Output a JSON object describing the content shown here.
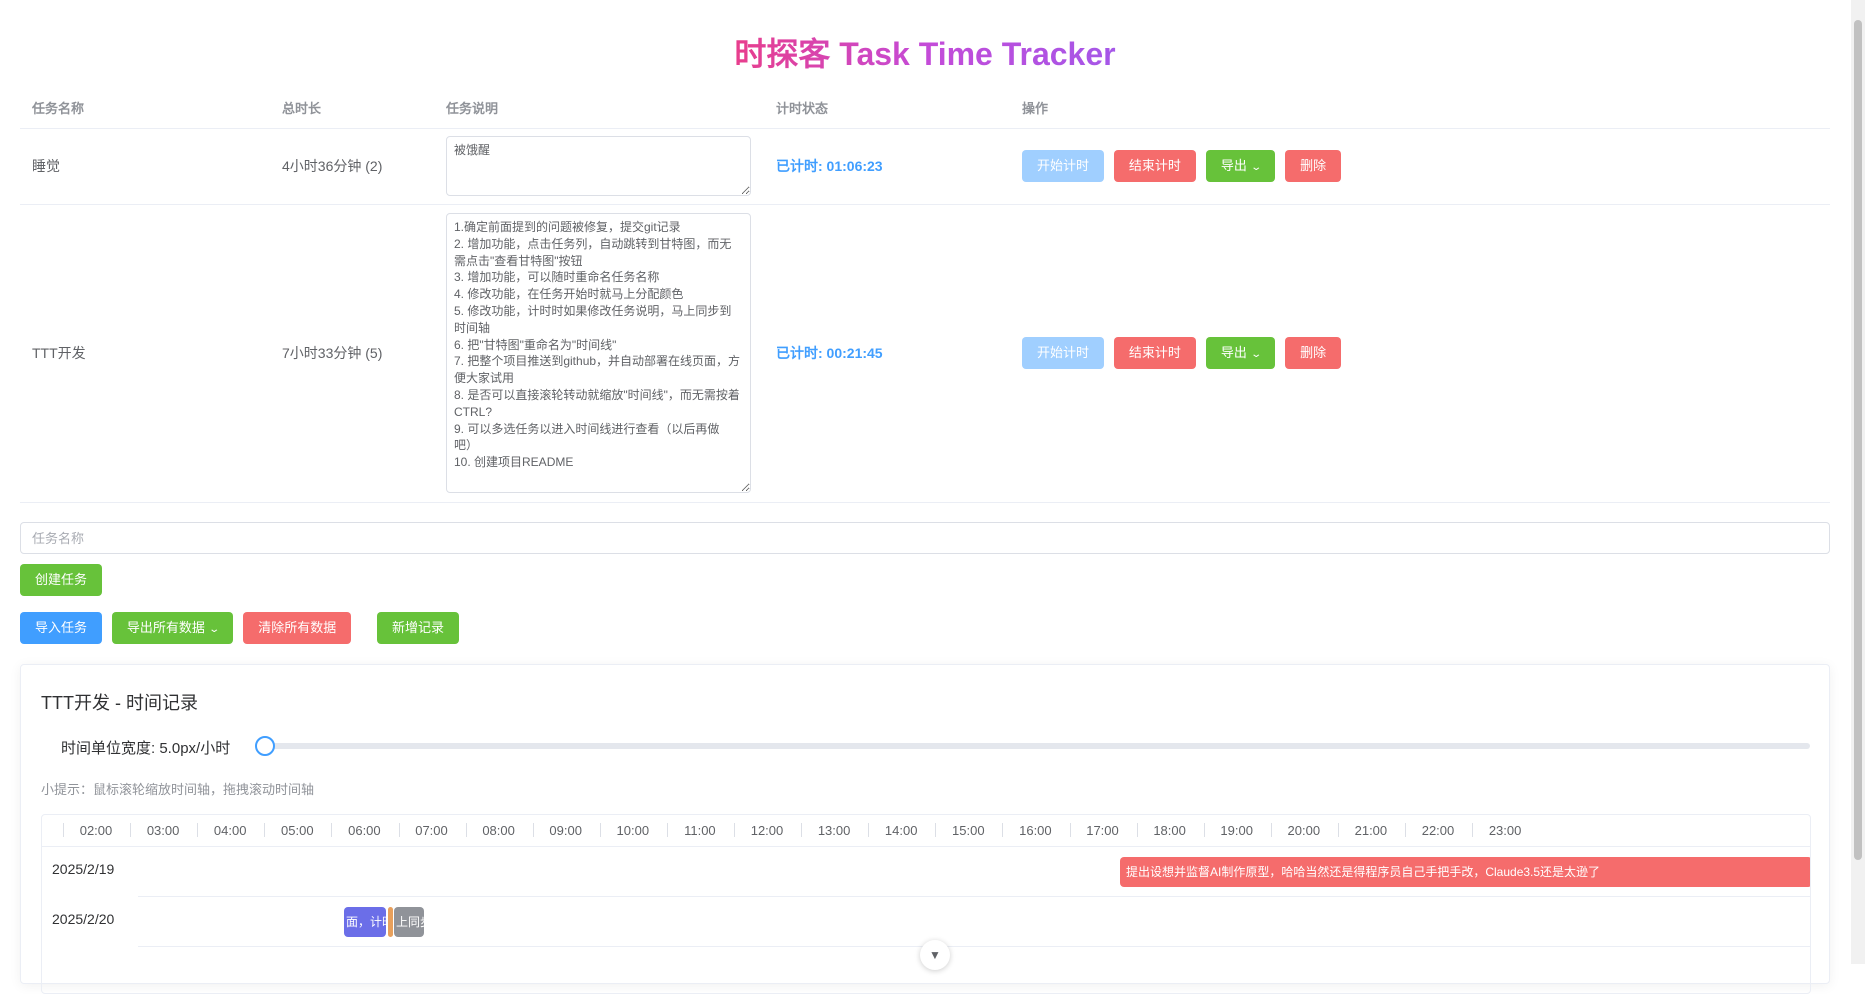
{
  "app": {
    "title": "时探客 Task Time Tracker"
  },
  "table": {
    "headers": [
      "任务名称",
      "总时长",
      "任务说明",
      "计时状态",
      "操作"
    ],
    "rows": [
      {
        "name": "睡觉",
        "total": "4小时36分钟 (2)",
        "desc": "被饿醒",
        "status": "已计时: 01:06:23"
      },
      {
        "name": "TTT开发",
        "total": "7小时33分钟 (5)",
        "desc": "1.确定前面提到的问题被修复，提交git记录\n2. 增加功能，点击任务列，自动跳转到甘特图，而无需点击\"查看甘特图\"按钮\n3. 增加功能，可以随时重命名任务名称\n4. 修改功能，在任务开始时就马上分配颜色\n5. 修改功能，计时时如果修改任务说明，马上同步到时间轴\n6. 把\"甘特图\"重命名为\"时间线\"\n7. 把整个项目推送到github，并自动部署在线页面，方便大家试用\n8. 是否可以直接滚轮转动就缩放\"时间线\"，而无需按着CTRL?\n9. 可以多选任务以进入时间线进行查看（以后再做吧）\n10. 创建项目README",
        "status": "已计时: 00:21:45"
      }
    ],
    "actions": {
      "start": "开始计时",
      "stop": "结束计时",
      "export": "导出",
      "delete": "删除"
    }
  },
  "new_task": {
    "placeholder": "任务名称",
    "create_label": "创建任务"
  },
  "toolbar": {
    "import_label": "导入任务",
    "export_all_label": "导出所有数据",
    "clear_all_label": "清除所有数据",
    "add_record_label": "新增记录"
  },
  "timeline": {
    "title": "TTT开发 - 时间记录",
    "unit_label": "时间单位宽度: 5.0px/小时",
    "slider_value_fraction": 0.0,
    "hint": "小提示：鼠标滚轮缩放时间轴，拖拽滚动时间轴",
    "hours": [
      "02:00",
      "03:00",
      "04:00",
      "05:00",
      "06:00",
      "07:00",
      "08:00",
      "09:00",
      "10:00",
      "11:00",
      "12:00",
      "13:00",
      "14:00",
      "15:00",
      "16:00",
      "17:00",
      "18:00",
      "19:00",
      "20:00",
      "21:00",
      "22:00",
      "23:00"
    ],
    "rows": [
      {
        "date": "2025/2/19",
        "segments": [
          {
            "text": "提出设想并监督AI制作原型，哈哈当然还是得程序员自己手把手改，Claude3.5还是太逊了",
            "color": "#f56c6c"
          }
        ]
      },
      {
        "date": "2025/2/20",
        "segments": [
          {
            "text": "面，计时",
            "color": "#6b6ee8"
          },
          {
            "text": "",
            "color": "#e8a05c"
          },
          {
            "text": "上同步",
            "color": "#909399"
          }
        ]
      }
    ]
  },
  "colors": {
    "primary": "#409eff",
    "success": "#67c23a",
    "danger": "#f56c6c",
    "disabled_primary": "#a0cfff"
  }
}
